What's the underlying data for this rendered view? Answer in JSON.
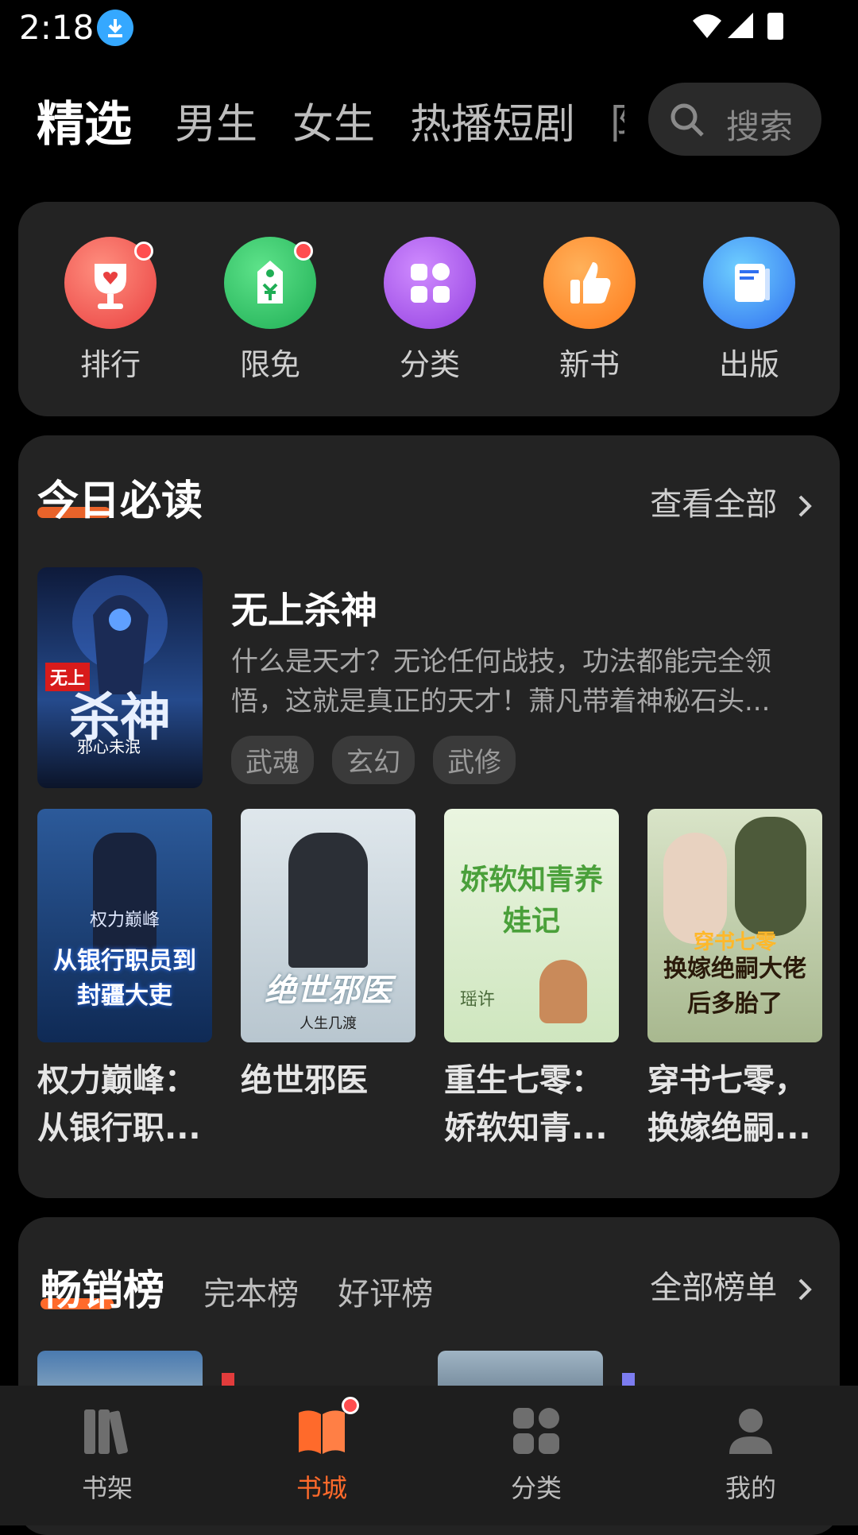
{
  "status_bar": {
    "time": "2:18"
  },
  "top_nav": {
    "tabs": [
      {
        "label": "精选",
        "active": true
      },
      {
        "label": "男生",
        "active": false
      },
      {
        "label": "女生",
        "active": false
      },
      {
        "label": "热播短剧",
        "active": false
      },
      {
        "label": "阝",
        "active": false
      }
    ],
    "search": {
      "placeholder": "搜索"
    }
  },
  "quick_actions": [
    {
      "label": "排行",
      "icon": "trophy-icon",
      "color": "#f05a5a",
      "badge": true
    },
    {
      "label": "限免",
      "icon": "price-tag-icon",
      "color": "#27c064",
      "badge": true
    },
    {
      "label": "分类",
      "icon": "grid-icon",
      "color": "#a64de6",
      "badge": false
    },
    {
      "label": "新书",
      "icon": "thumbs-up-icon",
      "color": "#ff8a2a",
      "badge": false
    },
    {
      "label": "出版",
      "icon": "book-icon",
      "color": "#2f7ff0",
      "badge": false
    }
  ],
  "must_read": {
    "title": "今日必读",
    "view_all": "查看全部",
    "featured": {
      "title": "无上杀神",
      "cover_title": "杀神",
      "cover_author": "邪心未泯",
      "description": "什么是天才？无论任何战技，功法都能完全领悟，这就是真正的天才！萧凡带着神秘石头...",
      "tags": [
        "武魂",
        "玄幻",
        "武修"
      ]
    },
    "books": [
      {
        "name": "权力巅峰：从银行职...",
        "cover_title": "从银行职员到封疆大吏",
        "cover_author": "权力巅峰"
      },
      {
        "name": "绝世邪医",
        "cover_title": "绝世邪医",
        "cover_author": "人生几渡"
      },
      {
        "name": "重生七零：娇软知青...",
        "cover_title": "娇软知青养娃记",
        "cover_author": "瑶许"
      },
      {
        "name": "穿书七零，换嫁绝嗣...",
        "cover_title": "换嫁绝嗣大佬后多胎了",
        "cover_author": "穿书七零"
      }
    ]
  },
  "ranking": {
    "tabs": [
      {
        "label": "畅销榜",
        "active": true
      },
      {
        "label": "完本榜",
        "active": false
      },
      {
        "label": "好评榜",
        "active": false
      }
    ],
    "all_lists": "全部榜单"
  },
  "bottom_nav": [
    {
      "label": "书架",
      "icon": "bookshelf-icon",
      "active": false
    },
    {
      "label": "书城",
      "icon": "open-book-icon",
      "active": true
    },
    {
      "label": "分类",
      "icon": "category-icon",
      "active": false
    },
    {
      "label": "我的",
      "icon": "person-icon",
      "active": false
    }
  ],
  "colors": {
    "accent": "#ff6a2b",
    "background": "#000000",
    "card": "#232323"
  }
}
